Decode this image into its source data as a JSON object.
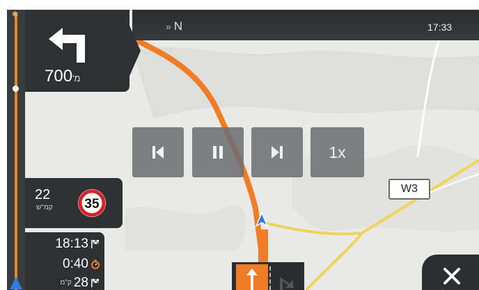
{
  "status_bar": {
    "heading_arrow": "»",
    "heading": "N",
    "clock": "17:33"
  },
  "turn": {
    "icon": "turn-left-icon",
    "distance": "700",
    "distance_unit": "מ'"
  },
  "speed": {
    "current": "22",
    "current_unit": "קמ\"ש",
    "limit": "35"
  },
  "eta": {
    "arrival_time": "18:13",
    "remaining_time": "0:40",
    "remaining_distance": "28",
    "remaining_distance_unit": "ק\"מ"
  },
  "playback": {
    "prev_icon": "skip-previous-icon",
    "pause_icon": "pause-icon",
    "next_icon": "skip-next-icon",
    "speed_label": "1x"
  },
  "waypoint_label": "W3",
  "close_icon": "close-icon",
  "colors": {
    "route": "#f07c26",
    "panel": "#2f3032",
    "position_marker": "#2f7de1",
    "speed_limit_ring": "#d6232a",
    "secondary_road": "#f2d35a"
  }
}
